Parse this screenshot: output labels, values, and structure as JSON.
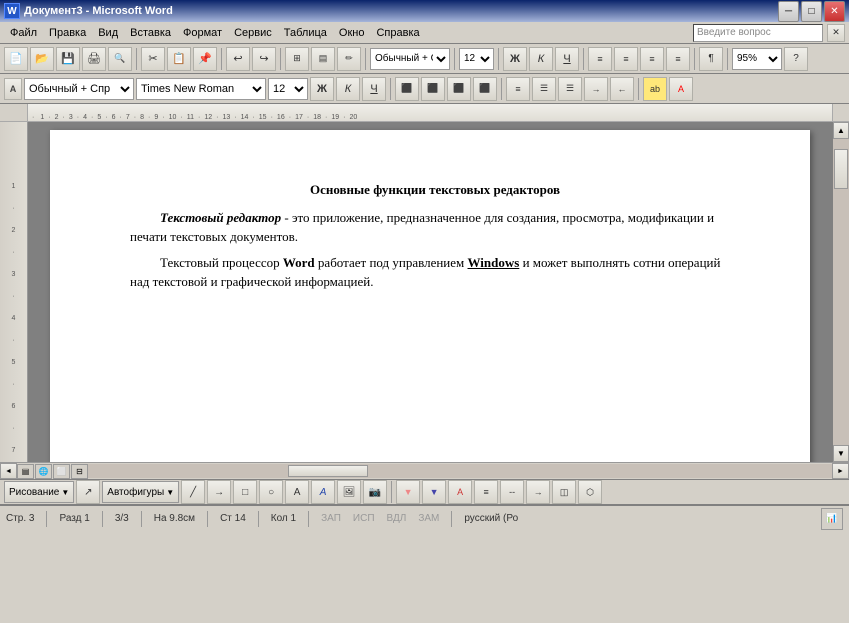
{
  "titlebar": {
    "title": "Документ3 - Microsoft Word",
    "icon": "W",
    "min_btn": "─",
    "max_btn": "□",
    "close_btn": "✕"
  },
  "menubar": {
    "items": [
      "Файл",
      "Правка",
      "Вид",
      "Вставка",
      "Формат",
      "Сервис",
      "Таблица",
      "Окно",
      "Справка"
    ],
    "search_placeholder": "Введите вопрос"
  },
  "toolbar1": {
    "buttons": [
      "📄",
      "📂",
      "💾",
      "🖨",
      "🔍",
      "✂",
      "📋",
      "📌",
      "↩",
      "↪"
    ],
    "font_size": "12",
    "zoom": "95%",
    "style_label": "Обычный + Спр"
  },
  "formatbar": {
    "style": "Обычный + Спр",
    "font": "Times New Roman",
    "size": "12",
    "bold": "Ж",
    "italic": "К",
    "underline": "Ч"
  },
  "document": {
    "heading": "Основные функции текстовых редакторов",
    "para1_bold_italic": "Текстовый редактор",
    "para1_rest": " - это приложение, предназначенное для создания, просмотра, модификации и печати текстовых документов.",
    "para2_start": "Текстовый процессор ",
    "para2_bold": "Word",
    "para2_mid": " работает под управлением ",
    "para2_bold2": "Windows",
    "para2_end": " и может выполнять сотни операций над текстовой и графической информацией."
  },
  "statusbar": {
    "page": "Стр. 3",
    "section": "Разд 1",
    "pages": "3/3",
    "cursor": "На 9.8см",
    "line": "Ст 14",
    "col": "Кол 1",
    "zap": "ЗАП",
    "isp": "ИСП",
    "vdl": "ВДЛ",
    "zam": "ЗАМ",
    "lang": "русский (Ро"
  },
  "drawbar": {
    "drawing": "Рисование",
    "autoshapes": "Автофигуры"
  }
}
